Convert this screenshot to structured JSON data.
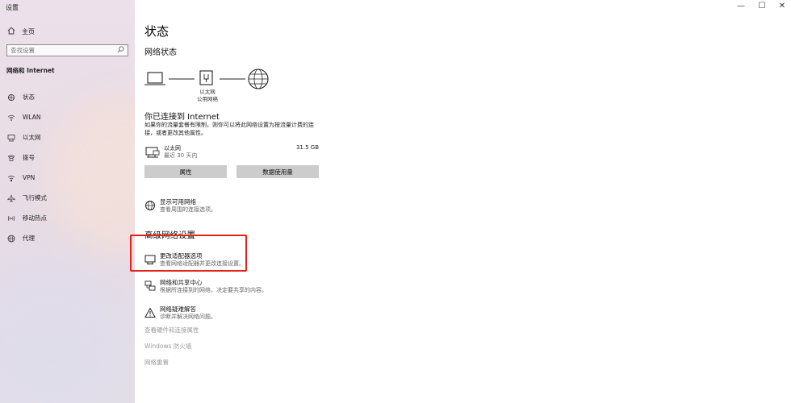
{
  "window": {
    "title": "设置",
    "controls": {
      "minimize": "—",
      "maximize": "☐",
      "close": "✕"
    }
  },
  "sidebar": {
    "home_label": "主页",
    "search_placeholder": "查找设置",
    "section_label": "网络和 Internet",
    "items": [
      {
        "label": "状态",
        "icon": "home-network-icon"
      },
      {
        "label": "WLAN",
        "icon": "wifi-icon"
      },
      {
        "label": "以太网",
        "icon": "ethernet-icon"
      },
      {
        "label": "拨号",
        "icon": "phone-icon"
      },
      {
        "label": "VPN",
        "icon": "vpn-icon"
      },
      {
        "label": "飞行模式",
        "icon": "airplane-icon"
      },
      {
        "label": "移动热点",
        "icon": "hotspot-icon"
      },
      {
        "label": "代理",
        "icon": "globe-icon"
      }
    ]
  },
  "main": {
    "title": "状态",
    "network_status_heading": "网络状态",
    "diagram": {
      "caption_line1": "以太网",
      "caption_line2": "公用网络"
    },
    "connected_title": "你已连接到 Internet",
    "connected_desc": "如果你的流量套餐有限制，则你可以将此网络设置为按流量计费的连接，或者更改其他属性。",
    "ethernet": {
      "name": "以太网",
      "sub": "最近 30 天内",
      "usage": "31.5 GB"
    },
    "buttons": {
      "properties": "属性",
      "data_usage": "数据使用量"
    },
    "show_networks": {
      "title": "显示可用网络",
      "desc": "查看周围的连接选项。"
    },
    "advanced_heading": "高级网络设置",
    "adapter": {
      "title": "更改适配器选项",
      "desc": "查看网络适配器并更改连接设置。"
    },
    "sharing": {
      "title": "网络和共享中心",
      "desc": "根据所连接到的网络，决定要共享的内容。"
    },
    "troubleshoot": {
      "title": "网络疑难解答",
      "desc": "诊断并解决网络问题。"
    },
    "links": {
      "hardware": "查看硬件和连接属性",
      "firewall": "Windows 防火墙",
      "reset": "网络重置"
    }
  },
  "colors": {
    "highlight": "#e2231a",
    "button_bg": "#cccccc",
    "sidebar_bg": "#e9dde6"
  }
}
